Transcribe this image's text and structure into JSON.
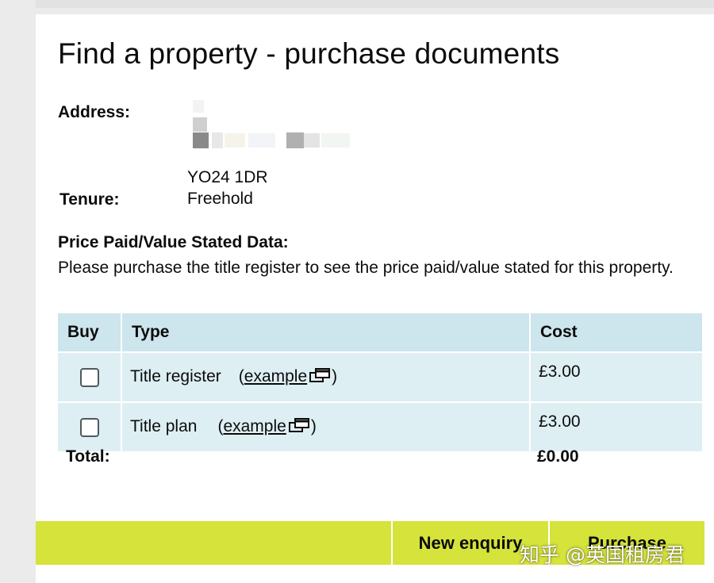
{
  "page": {
    "title": "Find a property - purchase documents"
  },
  "property": {
    "address_label": "Address:",
    "postcode": "YO24 1DR",
    "tenure_label": "Tenure:",
    "tenure": "Freehold"
  },
  "price_paid": {
    "heading": "Price Paid/Value Stated Data:",
    "message": "Please purchase the title register to see the price paid/value stated for this property."
  },
  "documents": {
    "headers": {
      "buy": "Buy",
      "type": "Type",
      "cost": "Cost"
    },
    "rows": [
      {
        "type": "Title register",
        "example_link": "example",
        "cost": "£3.00",
        "checked": false
      },
      {
        "type": "Title plan",
        "example_link": "example",
        "cost": "£3.00",
        "checked": false
      }
    ],
    "total_label": "Total:",
    "total": "£0.00"
  },
  "footer": {
    "new_enquiry_label": "New enquiry",
    "purchase_label": "Purchase"
  },
  "watermark": "知乎 @英国租房君",
  "colors": {
    "table_header_bg": "#cde5ec",
    "table_row_bg": "#deeff3",
    "footer_bar_bg": "#d5e33a"
  },
  "icons": {
    "example_link_icon": "open-in-new-window-icon"
  }
}
